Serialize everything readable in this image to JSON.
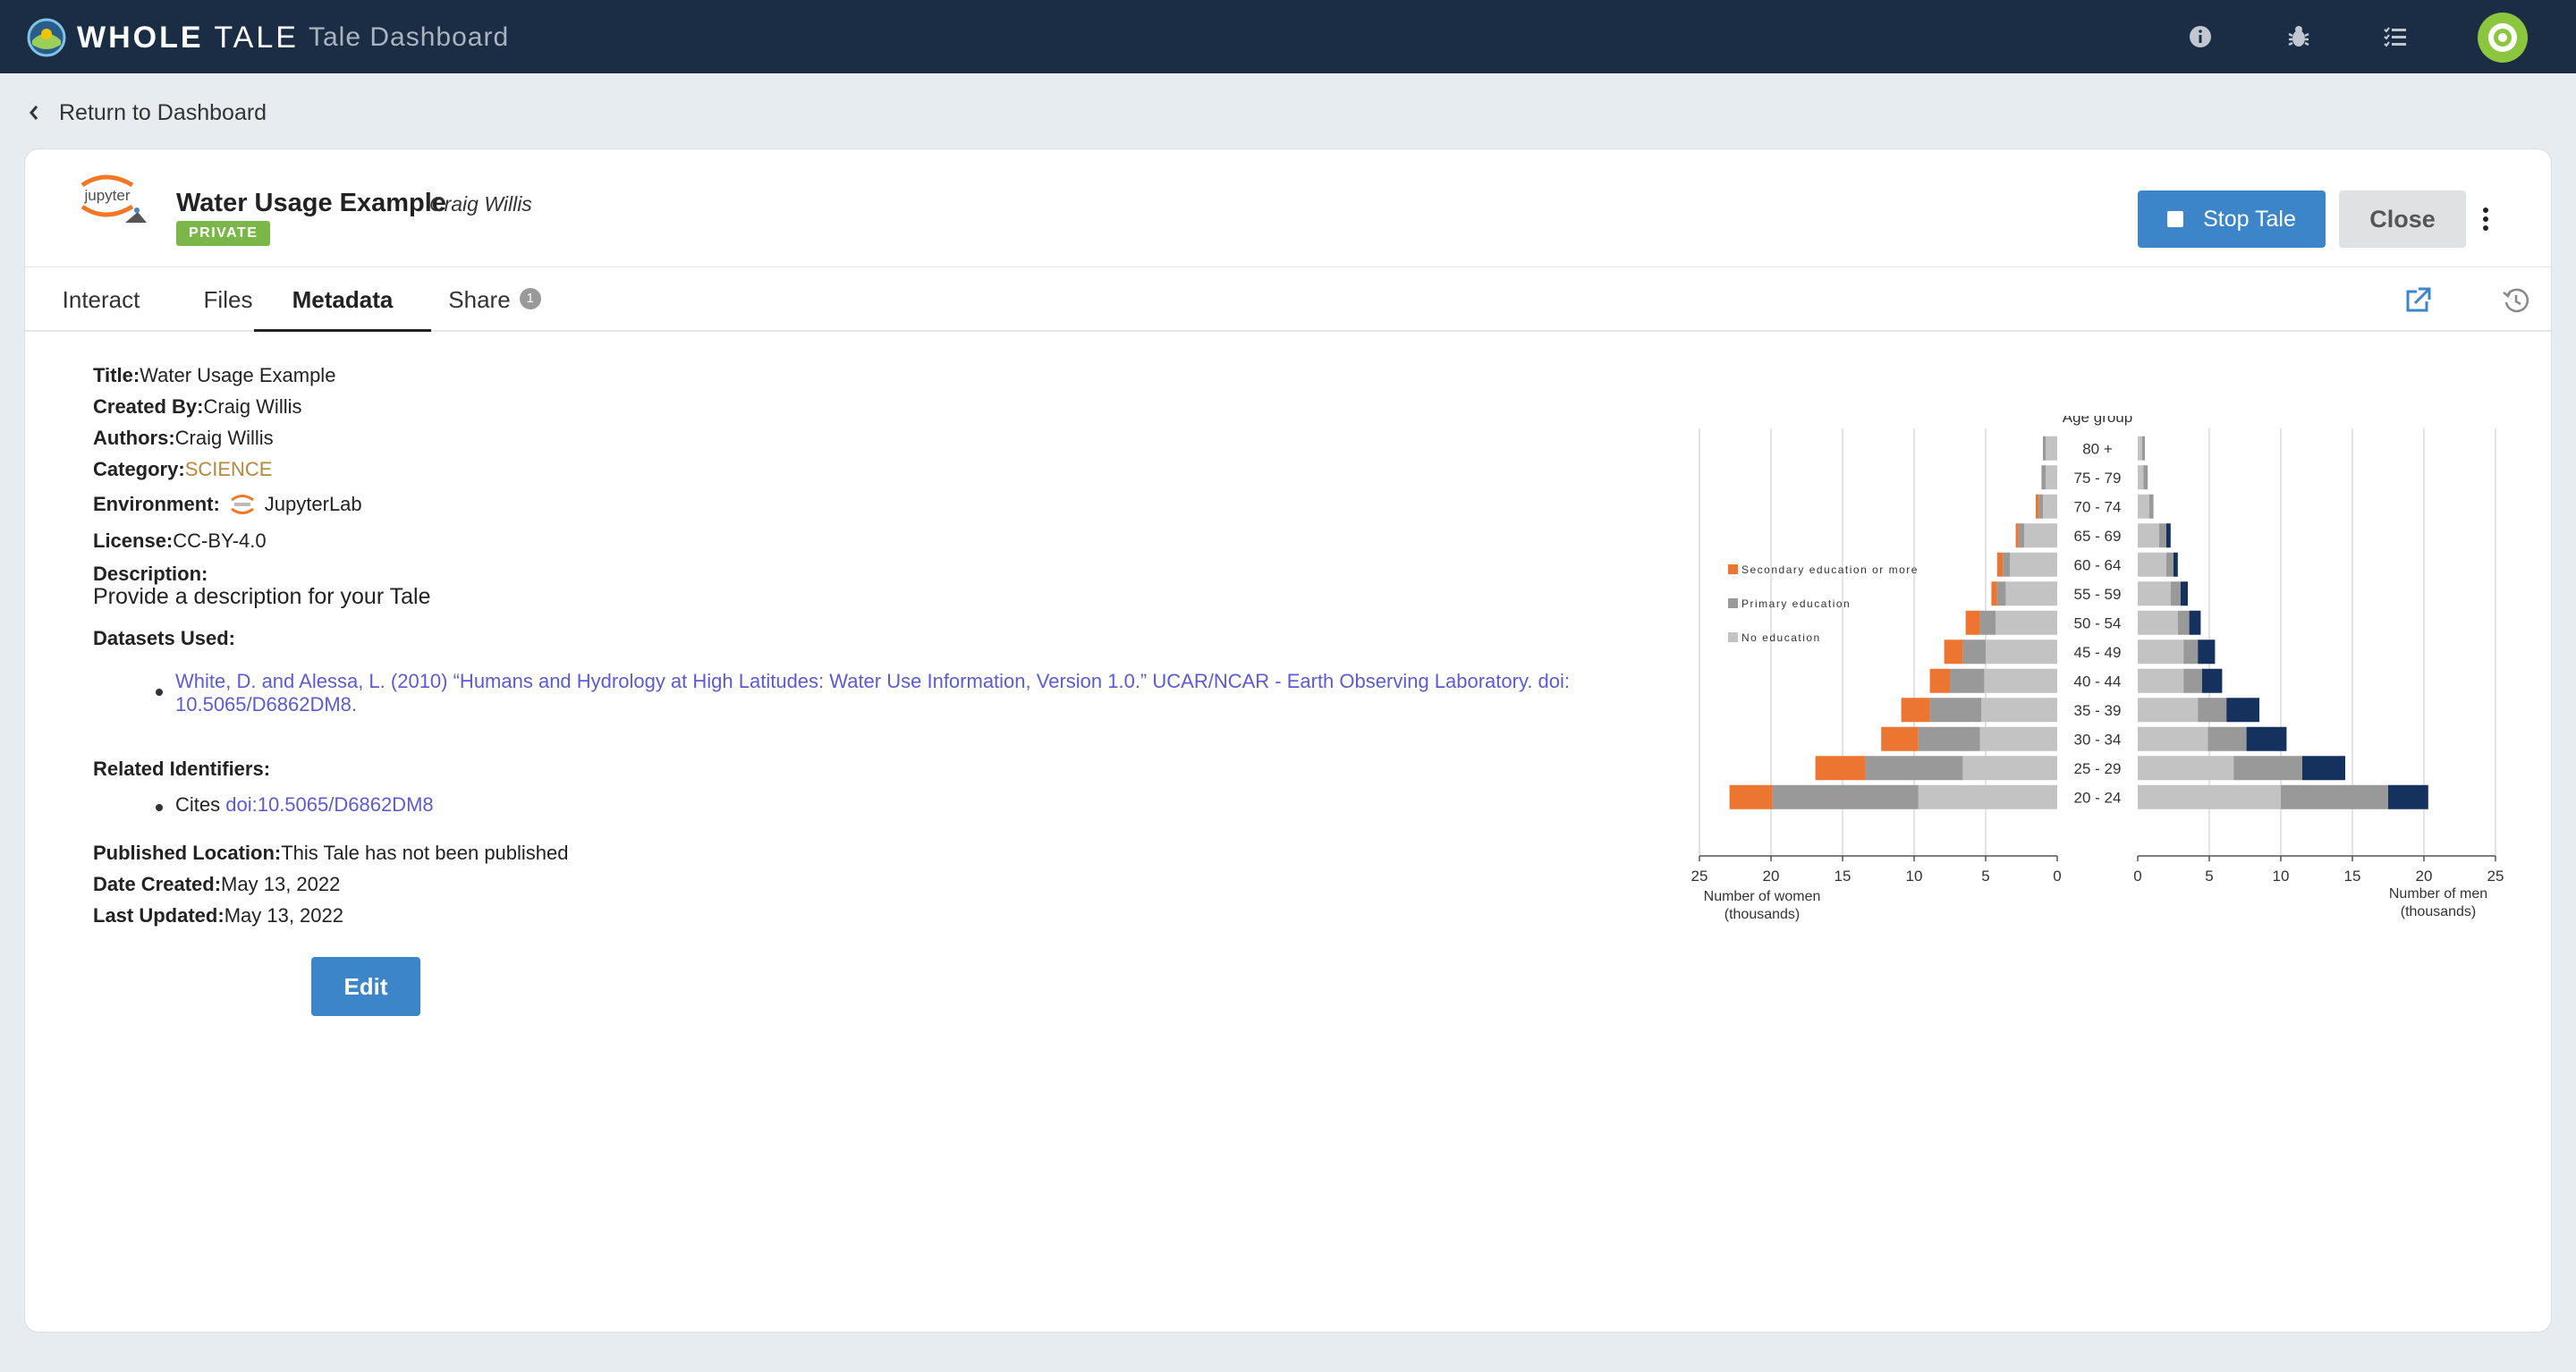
{
  "topbar": {
    "brand_bold": "WHOLE",
    "brand_light": "TALE",
    "page_title": "Tale Dashboard",
    "icons": [
      "info-icon",
      "bug-icon",
      "tasks-icon"
    ],
    "colors": {
      "bar": "#1b2d44",
      "avatar": "#8cc63f"
    }
  },
  "nav": {
    "return_label": "Return to Dashboard"
  },
  "tale": {
    "name": "Water Usage Example",
    "author": "Craig Willis",
    "badge": "PRIVATE",
    "logo_text": "jupyter",
    "stop_label": "Stop Tale",
    "close_label": "Close"
  },
  "tabs": [
    {
      "label": "Interact"
    },
    {
      "label": "Files"
    },
    {
      "label": "Metadata",
      "active": true
    },
    {
      "label": "Share",
      "badge": "1"
    }
  ],
  "metadata": {
    "title_label": "Title:",
    "title_value": "Water Usage Example",
    "created_by_label": "Created By:",
    "created_by_value": "Craig Willis",
    "authors_label": "Authors:",
    "authors_value": "Craig Willis",
    "category_label": "Category:",
    "category_value": "SCIENCE",
    "environment_label": "Environment:",
    "environment_value": "JupyterLab",
    "license_label": "License:",
    "license_value": "CC-BY-4.0",
    "description_label": "Description:",
    "description_value": "Provide a description for your Tale",
    "datasets_label": "Datasets Used:",
    "dataset_line1": "White, D. and Alessa, L. (2010) “Humans and Hydrology at High Latitudes: Water Use Information, Version 1.0.” UCAR/NCAR - Earth Observing Laboratory. doi:",
    "dataset_line2": "10.5065/D6862DM8.",
    "related_label": "Related Identifiers:",
    "related_prefix": "Cites",
    "related_doi": "doi:10.5065/D6862DM8",
    "published_label": "Published Location:",
    "published_value": "This Tale has not been published",
    "date_created_label": "Date Created:",
    "date_created_value": "May 13, 2022",
    "last_updated_label": "Last Updated:",
    "last_updated_value": "May 13, 2022",
    "edit_label": "Edit"
  },
  "chart_data": {
    "type": "bar",
    "title": "Age group",
    "categories": [
      "80 +",
      "75 - 79",
      "70 - 74",
      "65 - 69",
      "60 - 64",
      "55 - 59",
      "50 - 54",
      "45 - 49",
      "40 - 44",
      "35 - 39",
      "30 - 34",
      "25 - 29",
      "20 - 24"
    ],
    "left_label_1": "Number of women",
    "left_label_2": "(thousands)",
    "right_label_1": "Number of men",
    "right_label_2": "(thousands)",
    "xlim": [
      0,
      25
    ],
    "xticks": [
      "25",
      "20",
      "15",
      "10",
      "5",
      "0"
    ],
    "xticks_right": [
      "0",
      "5",
      "10",
      "15",
      "20",
      "25"
    ],
    "legend": [
      "Secondary education or more",
      "Primary education",
      "No education"
    ],
    "legend_placement": "left",
    "colors": {
      "no_education": "#c3c3c3",
      "primary_women": "#999999",
      "secondary_women": "#ec7531",
      "primary_men": "#999999",
      "secondary_men": "#15325e"
    },
    "women": {
      "no_education": [
        0.8,
        0.8,
        1.0,
        2.3,
        3.3,
        3.6,
        4.3,
        5.0,
        5.1,
        5.3,
        5.4,
        6.6,
        9.7
      ],
      "primary": [
        0.2,
        0.3,
        0.3,
        0.4,
        0.5,
        0.6,
        1.1,
        1.6,
        2.4,
        3.6,
        4.3,
        6.8,
        10.2
      ],
      "secondary": [
        0.0,
        0.0,
        0.2,
        0.2,
        0.4,
        0.4,
        1.0,
        1.3,
        1.4,
        2.0,
        2.6,
        3.5,
        3.0
      ]
    },
    "men": {
      "no_education": [
        0.3,
        0.4,
        0.8,
        1.5,
        2.0,
        2.3,
        2.8,
        3.2,
        3.2,
        4.2,
        4.9,
        6.7,
        10.0
      ],
      "primary": [
        0.2,
        0.3,
        0.3,
        0.5,
        0.5,
        0.7,
        0.8,
        1.0,
        1.3,
        2.0,
        2.7,
        4.8,
        7.5
      ],
      "secondary": [
        0.0,
        0.0,
        0.0,
        0.3,
        0.3,
        0.5,
        0.8,
        1.2,
        1.4,
        2.3,
        2.8,
        3.0,
        2.8
      ]
    }
  }
}
